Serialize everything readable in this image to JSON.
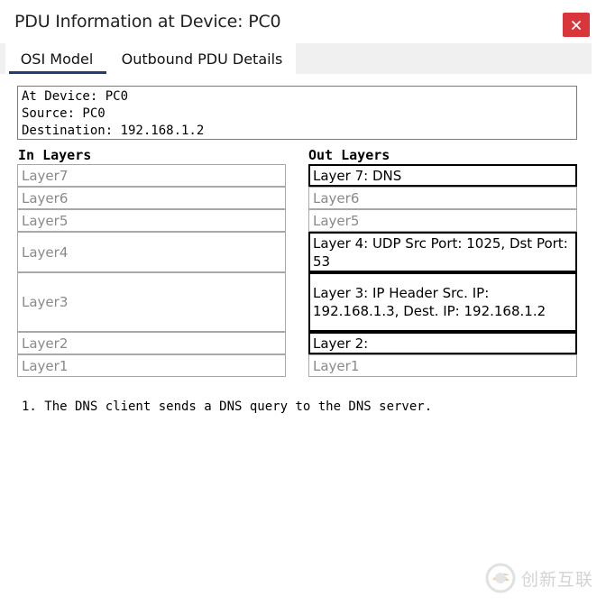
{
  "window": {
    "title": "PDU Information at Device: PC0"
  },
  "tabs": [
    {
      "label": "OSI Model",
      "active": true
    },
    {
      "label": "Outbound PDU Details",
      "active": false
    }
  ],
  "info": {
    "device_line": "At Device: PC0",
    "source_line": "Source: PC0",
    "destination_line": "Destination: 192.168.1.2"
  },
  "in_layers": {
    "heading": "In Layers",
    "layers": [
      "Layer7",
      "Layer6",
      "Layer5",
      "Layer4",
      "Layer3",
      "Layer2",
      "Layer1"
    ]
  },
  "out_layers": {
    "heading": "Out Layers",
    "layers": [
      {
        "label": "Layer 7: DNS",
        "active": true
      },
      {
        "label": "Layer6",
        "active": false
      },
      {
        "label": "Layer5",
        "active": false
      },
      {
        "label": "Layer 4: UDP Src Port: 1025, Dst Port: 53",
        "active": true
      },
      {
        "label": "Layer 3: IP Header Src. IP: 192.168.1.3, Dest. IP: 192.168.1.2",
        "active": true
      },
      {
        "label": "Layer 2:",
        "active": true
      },
      {
        "label": "Layer1",
        "active": false
      }
    ]
  },
  "description": "1. The DNS client sends a DNS query to the DNS server.",
  "watermark": {
    "text": "创新互联"
  },
  "colors": {
    "close_button": "#d9363c",
    "tab_underline": "#1f3d73",
    "inactive_text": "#8a8a8a"
  }
}
